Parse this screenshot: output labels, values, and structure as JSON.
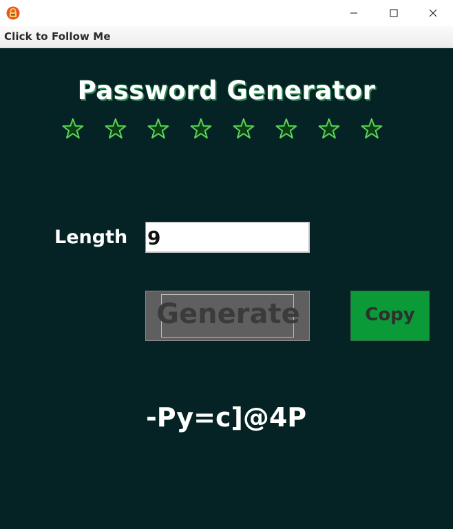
{
  "window": {
    "controls": {
      "minimize_icon": "minimize-icon",
      "maximize_icon": "maximize-icon",
      "close_icon": "close-icon"
    },
    "app_icon": "lock-app-icon"
  },
  "menubar": {
    "items": [
      {
        "label": "Click to Follow Me"
      }
    ]
  },
  "main": {
    "title": "Password Generator",
    "star_decoration": {
      "count": 8,
      "icon": "star-icon",
      "color": "#3fbf3f"
    },
    "length": {
      "label": "Length",
      "value": "9"
    },
    "generate_button": {
      "label": "Generate"
    },
    "copy_button": {
      "label": "Copy"
    },
    "password_output": "-Py=c]@4P"
  },
  "colors": {
    "background": "#052324",
    "copy_button": "#0a9a38",
    "generate_button": "#5f5f5f",
    "title_shadow": "#2e8b57"
  }
}
